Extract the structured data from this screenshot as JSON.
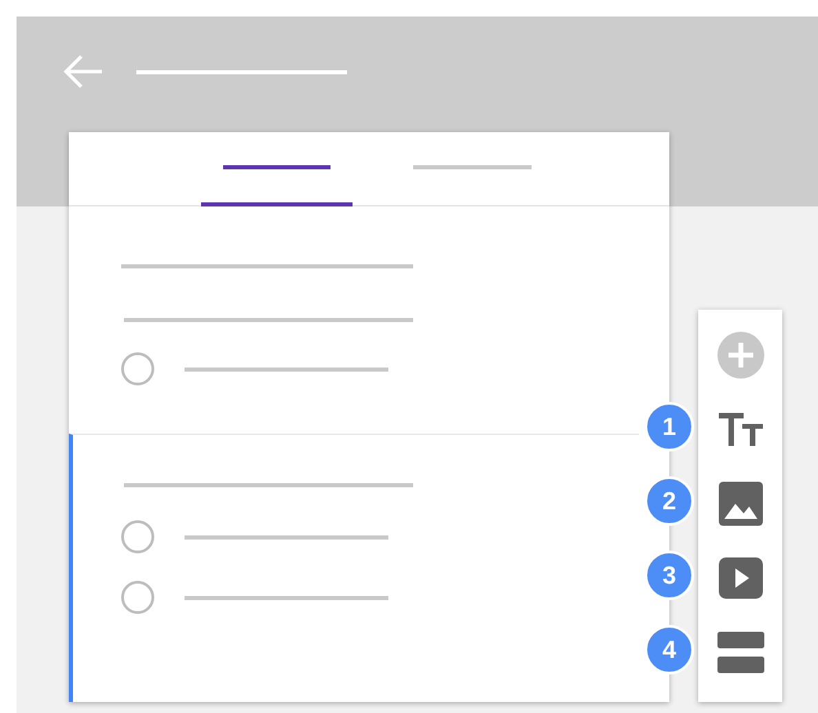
{
  "tabs": [
    {
      "selected": true
    },
    {
      "selected": false
    }
  ],
  "questions": [
    {
      "selected": false,
      "options": [
        {
          "checked": false
        }
      ]
    },
    {
      "selected": true,
      "options": [
        {
          "checked": false
        },
        {
          "checked": false
        }
      ]
    }
  ],
  "toolbar": [
    {
      "kind": "add",
      "disabled": true
    },
    {
      "kind": "title",
      "disabled": false,
      "badge": "1"
    },
    {
      "kind": "image",
      "disabled": false,
      "badge": "2"
    },
    {
      "kind": "video",
      "disabled": false,
      "badge": "3"
    },
    {
      "kind": "section",
      "disabled": false,
      "badge": "4"
    }
  ]
}
